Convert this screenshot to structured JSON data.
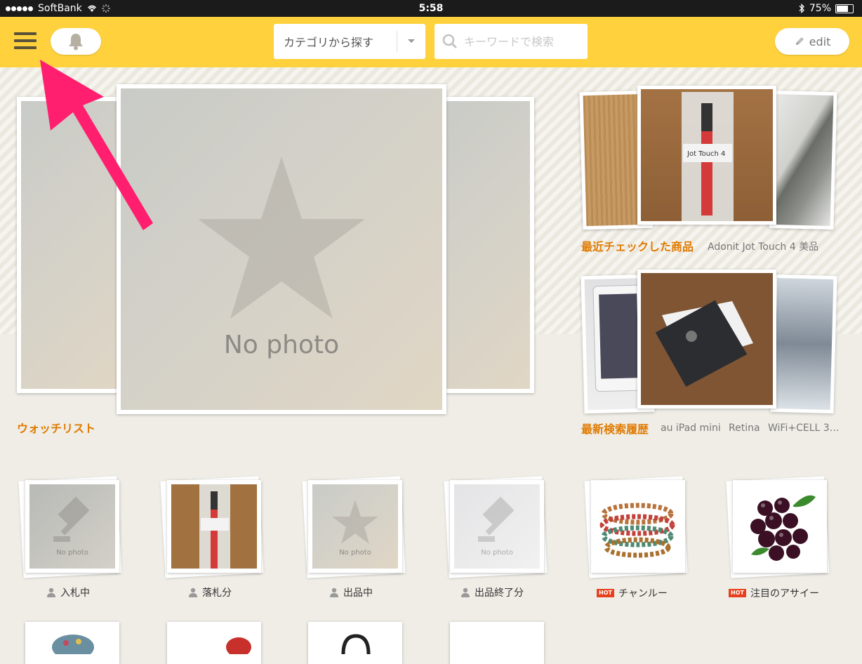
{
  "status_bar": {
    "carrier": "SoftBank",
    "time": "5:58",
    "battery": "75%"
  },
  "header": {
    "category_label": "カテゴリから探す",
    "search_placeholder": "キーワードで検索",
    "edit_label": "edit"
  },
  "watchlist": {
    "label": "ウォッチリスト",
    "no_photo_text": "No photo"
  },
  "recent_checked": {
    "label": "最近チェックした商品",
    "item": "Adonit Jot Touch 4 美品",
    "pen_label": "Jot Touch 4"
  },
  "recent_search": {
    "label": "最新検索履歴",
    "terms": [
      "au iPad mini",
      "Retina",
      "WiFi+CELL 3…"
    ]
  },
  "tiles": [
    {
      "label": "入札中",
      "icon": "person-icon",
      "badge": ""
    },
    {
      "label": "落札分",
      "icon": "person-icon",
      "badge": ""
    },
    {
      "label": "出品中",
      "icon": "person-icon",
      "badge": ""
    },
    {
      "label": "出品終了分",
      "icon": "person-icon",
      "badge": ""
    },
    {
      "label": "チャンルー",
      "icon": "hot-badge",
      "badge": "HOT"
    },
    {
      "label": "注目のアサイー",
      "icon": "hot-badge",
      "badge": "HOT"
    }
  ],
  "tile_no_photo": "No photo",
  "colors": {
    "header": "#ffd23d",
    "accent": "#e07a00",
    "hot": "#e8401c"
  }
}
